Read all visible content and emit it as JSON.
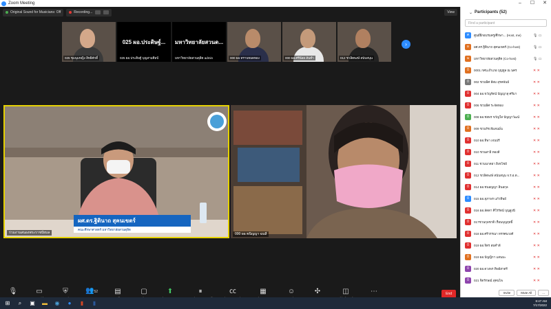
{
  "window": {
    "title": "Zoom Meeting"
  },
  "topbar": {
    "original_sound": "Original Sound for Musicians: Off",
    "recording": "Recording...",
    "view": "View"
  },
  "thumbnails": [
    {
      "label": "025 ชุมนุมหญิง สิทธิศักดิ์",
      "kind": "video",
      "skin": "#d4a88a",
      "shirt": "#3a3a3a"
    },
    {
      "label": "025 ผอ.ประดิษฐ์ บุญสามศิลป์",
      "kind": "text",
      "big": "025 ผอ.ประดิษฐ์..."
    },
    {
      "label": "มหาวิทยาลัยสวนดุสิต admin",
      "kind": "text",
      "big": "มหาวิทยาลัยสวนด..."
    },
    {
      "label": "000 ผอ.ทราบหมดทอง",
      "kind": "video",
      "skin": "#b98b6a",
      "shirt": "#2a2f4a"
    },
    {
      "label": "000 ผอ.ศรีน้อย สันทำ",
      "kind": "video",
      "skin": "#c49a7a",
      "shirt": "#e8e8e8"
    },
    {
      "label": "012 ชวลิตพงษ์ สนับสนุน",
      "kind": "video",
      "skin": "#b08060",
      "shirt": "#222222"
    }
  ],
  "videos": {
    "left_label": "ร่วมงานสนองพระราชปัยบล",
    "left_name": "ผศ.ดร.ฐิตินาถ สุคนเขตร์",
    "left_org": "คณะศึกษาศาสตร์ มหาวิทยาลัยสวนดุสิต",
    "right_label": "000 ผอ.ชนิญญา ฉนลี"
  },
  "toolbar": {
    "mute": "Mute",
    "stop_video": "Stop Video",
    "security": "Security",
    "participants": "Participants",
    "participants_count": "52",
    "polls": "Polls",
    "chat": "Chat",
    "share_screen": "Share Screen",
    "pause_recording": "Pause/Stop Recording",
    "live_transcript": "Live Transcript",
    "breakout_rooms": "Breakout Rooms",
    "reactions": "Reactions",
    "apps": "Apps",
    "whiteboards": "Whiteboards",
    "more": "More",
    "end": "End"
  },
  "panel": {
    "title": "Participants (52)",
    "search_placeholder": "Find a participant",
    "invite": "Invite",
    "mute_all": "Mute All",
    "more": "...",
    "participants": [
      {
        "name": "ศูนย์ฝึกอบรมครู/ศึกษา... (Host, me)",
        "initial": "ศ",
        "color": "#2d8cff"
      },
      {
        "name": "ผศ.ดร.ฐิตินาถ สุคนเขตร์ (Co-host)",
        "initial": "ผ",
        "color": "#e07020"
      },
      {
        "name": "มหาวิทยาลัยสวนดุสิต (Co-host)",
        "initial": "ม",
        "color": "#e07020"
      },
      {
        "name": "0001 กศน.อำเภอ บุญทูล ณ นคร",
        "initial": "0",
        "color": "#e07020"
      },
      {
        "name": "002 ชวนพิศ สีสม อุรคพันธ์",
        "initial": "0",
        "color": "#777777"
      },
      {
        "name": "004 ผอ.ขวัญรัตน์ ปัญญาสุ ศรีมา",
        "initial": "0",
        "color": "#e03030"
      },
      {
        "name": "006 ชวนพิศ ระจัดทอง",
        "initial": "0",
        "color": "#e03030"
      },
      {
        "name": "008 ผอ.ชยพร ขวัญใส ปัญญาวัฒน์",
        "initial": "0",
        "color": "#4caf50"
      },
      {
        "name": "009 ชวนรัช สีแดนมั่น",
        "initial": "0",
        "color": "#e07020"
      },
      {
        "name": "010 ผอ.ทิพา เจนปรี",
        "initial": "0",
        "color": "#e03030"
      },
      {
        "name": "010 ชวนสาธิ ทองสี",
        "initial": "0",
        "color": "#e03030"
      },
      {
        "name": "011 ชวนนาตยา สิงหไชย์",
        "initial": "0",
        "color": "#e03030"
      },
      {
        "name": "012 ชวลิตพงษ์ สนับสนุน จ.ร.อ.ต...",
        "initial": "0",
        "color": "#e03030"
      },
      {
        "name": "014 ผอ.ชนอญญา สินอกุล",
        "initial": "0",
        "color": "#e03030"
      },
      {
        "name": "015 ผอ.สุภาพร แก้วทิพย์",
        "initial": "0",
        "color": "#2d8cff"
      },
      {
        "name": "016 ผอ.ลัดดา ศิโรรัตน์ บุญสูงนี",
        "initial": "0",
        "color": "#e03030"
      },
      {
        "name": "017ชวนกุลชาติ เรือนบุญฤทธิ์",
        "initial": "0",
        "color": "#e03030"
      },
      {
        "name": "018 ผอ.ศรีวรรณา ทรรศนวงศ์",
        "initial": "0",
        "color": "#e03030"
      },
      {
        "name": "019 ผอ.จิตร สมคำลี",
        "initial": "0",
        "color": "#e03030"
      },
      {
        "name": "019 ผอ.ปัญญิกา แสนมะ",
        "initial": "0",
        "color": "#e07020"
      },
      {
        "name": "020 ผอ.ดวงพร ทิพย์สาตรี",
        "initial": "0",
        "color": "#8e44ad"
      },
      {
        "name": "021 จิตรักษณ์ สุคนไพ",
        "initial": "0",
        "color": "#8e44ad"
      }
    ]
  },
  "taskbar": {
    "time": "8:47 AM",
    "date": "7/17/2022"
  }
}
